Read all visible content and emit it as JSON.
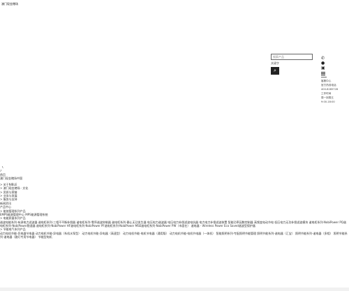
{
  "header": {
    "logo_text": "澳门现金赌场"
  },
  "search": {
    "placeholder": "搜索产品",
    "hint": "关键字",
    "button_icon": "search-icon"
  },
  "tools": {
    "phone_icon": "phone-icon",
    "pin_icon": "location-pin-icon",
    "user_icon": "user-icon",
    "menu_icon": "menu-icon",
    "info_lines": [
      "客服中心",
      "官方热线电话",
      "400-8285728",
      "工作时间",
      "周一到周五",
      "9:00-18:00"
    ]
  },
  "nav": {
    "arrow_prev": "〈",
    "arrow_next": "〉",
    "home": "首页",
    "about_heading": "澳门现金赌场中国",
    "items": [
      "> 关于NIBLE",
      "> 澳门现金赌场 · 文化",
      "> 资质与荣誉",
      "> 业务与发展",
      "> 服务与支持"
    ],
    "news": "新闻资讯",
    "product_center": "产品中心",
    "energy_series": "> 能效管理系列产品",
    "emps_line": "EMPS能源管理中心 MPS能源管理系统",
    "quality_series": "> 电能质量系列产品",
    "quality_products": "谐波电能系列-有源电力滤波器 谐电柜系列-三相不平衡补偿器 谐电柜系列-零序谐波抑制器 谐电柜系列-静止无功发生器 电压电力谐波器 电压电力补偿滤波电抗器 电力电力补偿滤波装置 智能功率因数控制器 高频变电动节电 低压电力无功补偿滤波模块 谐电柜系列-NobiPower PQ谐电柜系列-NobiPower稳速器 谐电柜系列-NobiPower HF谐电柜系列-NobiPower PF谐电柜系列-NobiPower MSE谐电柜系列-NobiPower PW（市面在） 谐电器 - Wireless Power Eco Saved谐波型保护器",
    "saving_series": "> 节能电气系列产品",
    "saving_products": "动力电机节能-异电器节电器 动力电机节能-异电器（系机水泵型） 动力电机节能-异电器（高速型） 动力电机节能-电机节电器（通用版） 动力电机节能-电机节电器（一体机） 智能照明系列-专配照明节能管理 照明节能系列-谐电器（汇宝） 照明节能系列-谐电器（多相） 照明节能系列-谐电器（路灯专用节电器） 节能型电机"
  },
  "colors": {
    "background": "#ffffff",
    "text": "#333333",
    "button": "#222222"
  }
}
